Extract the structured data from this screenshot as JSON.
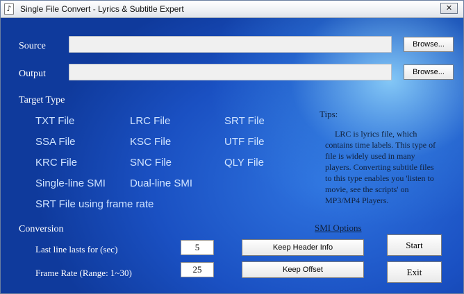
{
  "window": {
    "title": "Single File Convert - Lyrics & Subtitle Expert",
    "close_label": "✕"
  },
  "source": {
    "label": "Source",
    "value": "",
    "browse_label": "Browse..."
  },
  "output": {
    "label": "Output",
    "value": "",
    "browse_label": "Browse..."
  },
  "target_type": {
    "label": "Target Type",
    "options": [
      "TXT File",
      "LRC File",
      "SRT File",
      "SSA File",
      "KSC File",
      "UTF File",
      "KRC File",
      "SNC File",
      "QLY File",
      "Single-line SMI",
      "Dual-line SMI",
      "SRT File using frame rate"
    ]
  },
  "tips": {
    "title": "Tips:",
    "text": "LRC is lyrics file, which contains time labels. This type of file is widely used in many players. Converting subtitle files to this type enables you 'listen to movie, see the scripts' on MP3/MP4 Players."
  },
  "smi_options_label": "SMI Options",
  "conversion": {
    "label": "Conversion",
    "last_line_label": "Last line lasts for (sec)",
    "last_line_value": "5",
    "frame_rate_label": "Frame Rate (Range: 1~30)",
    "frame_rate_value": "25",
    "keep_header_label": "Keep Header Info",
    "keep_offset_label": "Keep Offset"
  },
  "actions": {
    "start_label": "Start",
    "exit_label": "Exit"
  },
  "colors": {
    "background": "#1c4fb8",
    "option_text": "#cfe3ff"
  }
}
